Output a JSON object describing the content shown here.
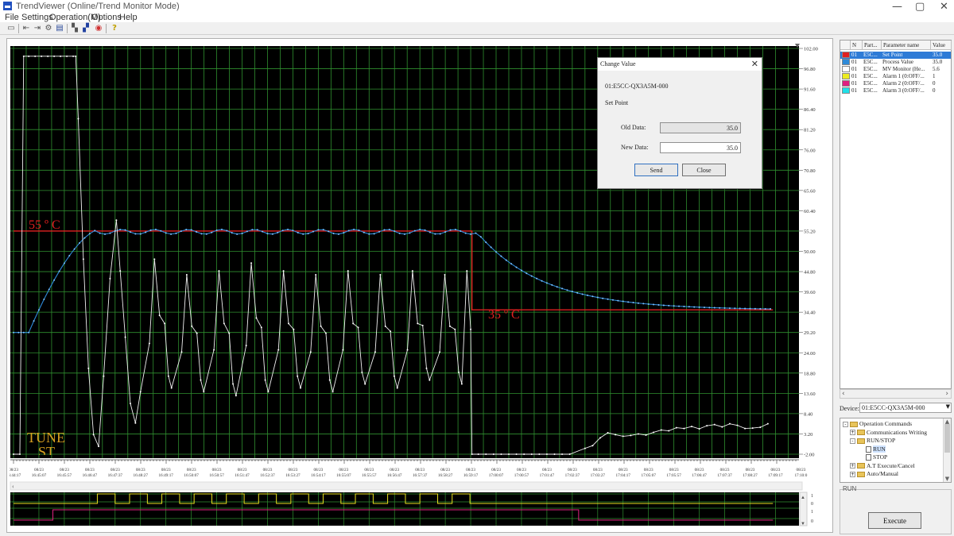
{
  "window": {
    "title": "TrendViewer (Online/Trend Monitor Mode)",
    "minimize": "—",
    "maximize": "▢"
  },
  "menu": [
    "File",
    "Settings",
    "Operation(M)",
    "Options",
    "Help"
  ],
  "toolbar_icons": [
    "open-icon",
    "scroll-left-icon",
    "scroll-right-icon",
    "settings-icon",
    "report-icon",
    "zoom-in-icon",
    "zoom-out-icon",
    "color-icon",
    "help-icon"
  ],
  "colors": {
    "plot_bg": "#000000",
    "grid": "#2f8f2f",
    "set_point": "#e02020",
    "process_value": "#2e8ad8",
    "mv_monitor": "#f0f0f0",
    "alarm1": "#e8e020",
    "alarm2": "#e02080",
    "selection": "#2e7bd6",
    "annotation_text": "#d8a020"
  },
  "chart_data": {
    "type": "line",
    "y_axis_ticks": [
      "102.00",
      "96.80",
      "91.60",
      "86.40",
      "81.20",
      "76.00",
      "70.80",
      "65.60",
      "60.40",
      "55.20",
      "50.00",
      "44.80",
      "39.60",
      "34.40",
      "29.20",
      "24.00",
      "18.80",
      "13.60",
      "8.40",
      "3.20",
      "-2.00"
    ],
    "ylim": [
      -2.0,
      102.0
    ],
    "x_ticks": [
      [
        "08/23",
        "16:44:17"
      ],
      [
        "08/23",
        "16:45:07"
      ],
      [
        "08/23",
        "16:45:57"
      ],
      [
        "08/23",
        "16:46:47"
      ],
      [
        "08/23",
        "16:47:37"
      ],
      [
        "08/23",
        "16:48:27"
      ],
      [
        "08/23",
        "16:49:17"
      ],
      [
        "08/23",
        "16:50:07"
      ],
      [
        "08/23",
        "16:50:57"
      ],
      [
        "08/23",
        "16:51:47"
      ],
      [
        "08/23",
        "16:52:37"
      ],
      [
        "08/23",
        "16:53:27"
      ],
      [
        "08/23",
        "16:54:17"
      ],
      [
        "08/23",
        "16:55:07"
      ],
      [
        "08/23",
        "16:55:57"
      ],
      [
        "08/23",
        "16:56:47"
      ],
      [
        "08/23",
        "16:57:37"
      ],
      [
        "08/23",
        "16:58:27"
      ],
      [
        "08/23",
        "16:59:17"
      ],
      [
        "08/23",
        "17:00:07"
      ],
      [
        "08/23",
        "17:00:57"
      ],
      [
        "08/23",
        "17:01:47"
      ],
      [
        "08/23",
        "17:02:37"
      ],
      [
        "08/23",
        "17:03:27"
      ],
      [
        "08/23",
        "17:04:17"
      ],
      [
        "08/23",
        "17:05:07"
      ],
      [
        "08/23",
        "17:05:57"
      ],
      [
        "08/23",
        "17:06:47"
      ],
      [
        "08/23",
        "17:07:37"
      ],
      [
        "08/23",
        "17:08:27"
      ],
      [
        "08/23",
        "17:09:17"
      ],
      [
        "08/23",
        "17:10:0"
      ]
    ],
    "grid": true,
    "annotations": [
      "55 º C",
      "35 º C",
      "TUNE",
      "ST"
    ],
    "series": [
      {
        "name": "Set Point",
        "segments": [
          [
            0,
            55.2
          ],
          [
            18.05,
            55.2
          ],
          [
            18.05,
            35.0
          ],
          [
            29.9,
            35.0
          ]
        ]
      },
      {
        "name": "Process Value",
        "shape": "rises from 29.2 to 55.2 by t=3.5, holds ~55.0 with small ripple until t=18.3, decays exponentially to 35.0 by t=29.9"
      },
      {
        "name": "MV Monitor (Heat)",
        "shape": "0 → 100 (t 0.5–2.5) → 0 at t≈3.5, then sustained oscillation ~2.5–55 (period ~1.3) until t=18, 0 until t≈22, then rises to ~6"
      }
    ],
    "digital_trend": {
      "y_ticks": [
        "1",
        "0",
        "1",
        "0"
      ],
      "series": [
        {
          "name": "Alarm 1 (0:OFF/...)",
          "shape": "square pulses between t=3.5 and t=18"
        },
        {
          "name": "Alarm 2 (0:OFF/...)",
          "shape": "high from t≈1.6 to t≈22.2, low otherwise"
        }
      ]
    }
  },
  "dialog": {
    "title": "Change Value",
    "device": "01:E5CC-QX3A5M-000",
    "param": "Set Point",
    "old_label": "Old Data:",
    "old_value": "35.0",
    "new_label": "New Data:",
    "new_value": "35.0",
    "send": "Send",
    "close": "Close"
  },
  "param_table": {
    "headers": [
      "N",
      "Part...",
      "Parameter name",
      "Value"
    ],
    "rows": [
      {
        "n": "01",
        "part": "E5C...",
        "name": "Set Point",
        "value": "35.0",
        "color": "#e02020",
        "selected": true
      },
      {
        "n": "01",
        "part": "E5C...",
        "name": "Process Value",
        "value": "35.0",
        "color": "#2e8ad8",
        "selected": false
      },
      {
        "n": "01",
        "part": "E5C...",
        "name": "MV Monitor (He...",
        "value": "5.6",
        "color": "#ffffff",
        "selected": false
      },
      {
        "n": "01",
        "part": "E5C...",
        "name": "Alarm 1 (0:OFF/...",
        "value": "1",
        "color": "#ecec20",
        "selected": false
      },
      {
        "n": "01",
        "part": "E5C...",
        "name": "Alarm 2 (0:OFF/...",
        "value": "0",
        "color": "#e02080",
        "selected": false
      },
      {
        "n": "01",
        "part": "E5C...",
        "name": "Alarm 3 (0:OFF/...",
        "value": "0",
        "color": "#20e0e8",
        "selected": false
      }
    ]
  },
  "device": {
    "label": "Device:",
    "value": "01:E5CC-QX3A5M-000"
  },
  "tree": [
    {
      "label": "Operation Commands",
      "level": 0,
      "type": "folder",
      "expand": "-"
    },
    {
      "label": "Communications Writing",
      "level": 1,
      "type": "folder",
      "expand": "+"
    },
    {
      "label": "RUN/STOP",
      "level": 1,
      "type": "folder",
      "expand": "-"
    },
    {
      "label": "RUN",
      "level": 2,
      "type": "doc",
      "expand": "",
      "selected": true
    },
    {
      "label": "STOP",
      "level": 2,
      "type": "doc",
      "expand": ""
    },
    {
      "label": "A.T Execute/Cancel",
      "level": 1,
      "type": "folder",
      "expand": "+"
    },
    {
      "label": "Auto/Manual",
      "level": 1,
      "type": "folder",
      "expand": "+"
    }
  ],
  "run_group": "RUN",
  "execute": "Execute"
}
